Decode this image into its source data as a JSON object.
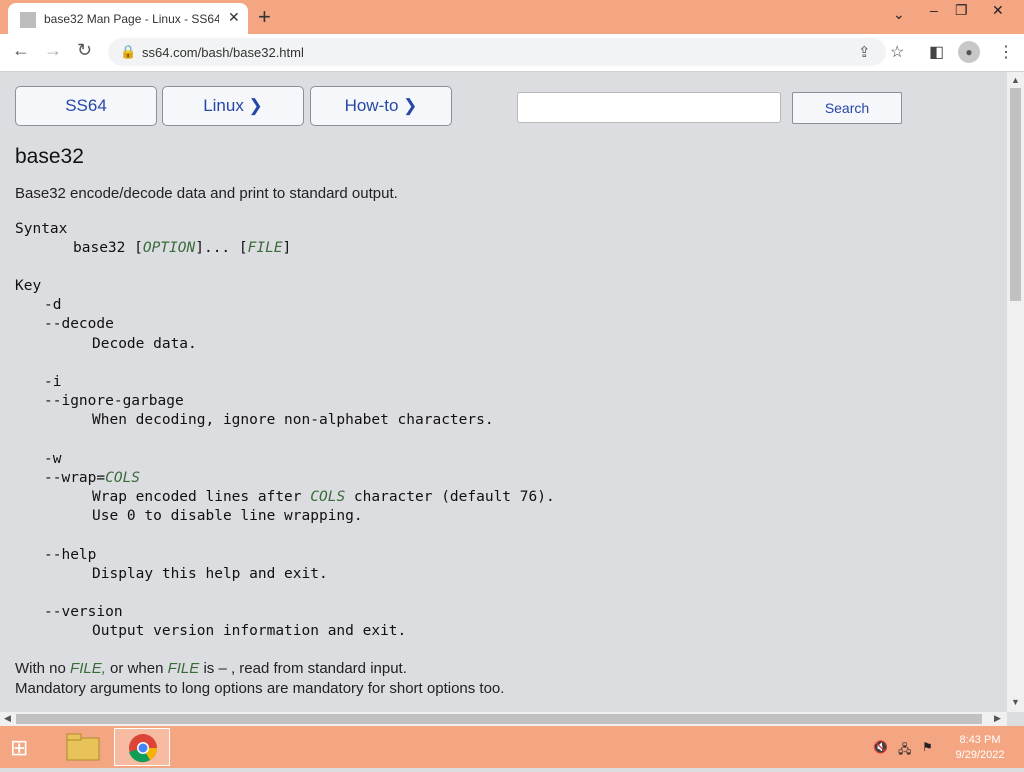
{
  "browser": {
    "tab_title": "base32 Man Page - Linux - SS64.",
    "tab_close": "✕",
    "new_tab": "+",
    "url": "ss64.com/bash/base32.html"
  },
  "nav": {
    "ss64": "SS64",
    "linux": "Linux ❯",
    "howto": "How-to ❯",
    "search_label": "Search",
    "search_value": ""
  },
  "page": {
    "title": "base32",
    "description": "Base32 encode/decode data and print to standard output.",
    "syntax_label": "Syntax",
    "syntax_cmd": "base32 [",
    "syntax_option": "OPTION",
    "syntax_mid": "]... [",
    "syntax_file": "FILE",
    "syntax_end": "]",
    "key_label": "Key",
    "opt_d": "-d",
    "opt_decode": "--decode",
    "opt_decode_desc": "Decode data.",
    "opt_i": "-i",
    "opt_ignore": "--ignore-garbage",
    "opt_ignore_desc": "When decoding, ignore non-alphabet characters.",
    "opt_w": "-w",
    "opt_wrap": "--wrap=",
    "opt_wrap_arg": "COLS",
    "opt_wrap_desc1_a": "Wrap encoded lines after ",
    "opt_wrap_desc1_arg": "COLS",
    "opt_wrap_desc1_b": " character (default 76).",
    "opt_wrap_desc2": "Use 0 to disable line wrapping.",
    "opt_help": "--help",
    "opt_help_desc": "Display this help and exit.",
    "opt_version": "--version",
    "opt_version_desc": "Output version information and exit.",
    "footer1_a": "With no ",
    "footer1_file": "FILE,",
    "footer1_b": " or when ",
    "footer1_file2": "FILE",
    "footer1_c": " is  –  , read from standard input.",
    "footer2": "Mandatory arguments to long options are mandatory for short options too."
  },
  "taskbar": {
    "time": "8:43 PM",
    "date": "9/29/2022"
  },
  "colors": {
    "tabbar": "#f4a582",
    "link_blue": "#2547a8",
    "arg_green": "#3a6b3a",
    "page_bg": "#dcdde1"
  }
}
